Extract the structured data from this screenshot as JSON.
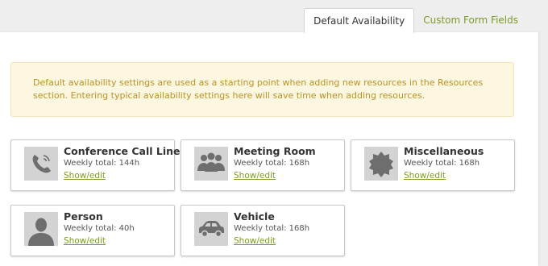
{
  "tabs": [
    {
      "label": "Default Availability",
      "active": true
    },
    {
      "label": "Custom Form Fields",
      "active": false
    }
  ],
  "notice": "Default availability settings are used as a starting point when adding new resources in the Resources section. Entering typical availability settings here will save time when adding resources.",
  "resources": [
    {
      "title": "Conference Call Line",
      "total": "Weekly total: 144h",
      "link": "Show/edit",
      "icon": "phone-icon"
    },
    {
      "title": "Meeting Room",
      "total": "Weekly total: 168h",
      "link": "Show/edit",
      "icon": "group-icon"
    },
    {
      "title": "Miscellaneous",
      "total": "Weekly total: 168h",
      "link": "Show/edit",
      "icon": "starburst-icon"
    },
    {
      "title": "Person",
      "total": "Weekly total: 40h",
      "link": "Show/edit",
      "icon": "person-icon"
    },
    {
      "title": "Vehicle",
      "total": "Weekly total: 168h",
      "link": "Show/edit",
      "icon": "car-icon"
    }
  ],
  "colors": {
    "accent": "#7d9b28",
    "notice_bg": "#fdf6e0",
    "notice_text": "#b99327"
  }
}
